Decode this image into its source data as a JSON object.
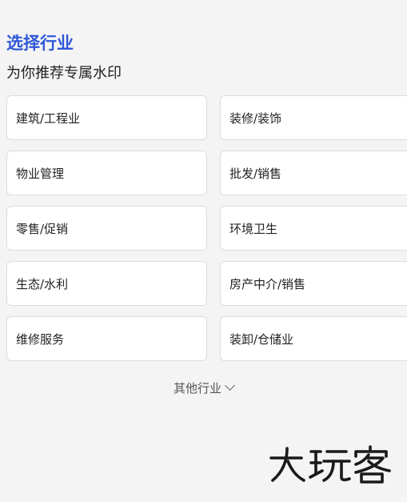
{
  "header": {
    "title": "选择行业",
    "subtitle": "为你推荐专属水印"
  },
  "industries": [
    {
      "label": "建筑/工程业"
    },
    {
      "label": "装修/装饰"
    },
    {
      "label": "物业管理"
    },
    {
      "label": "批发/销售"
    },
    {
      "label": "零售/促销"
    },
    {
      "label": "环境卫生"
    },
    {
      "label": "生态/水利"
    },
    {
      "label": "房产中介/销售"
    },
    {
      "label": "维修服务"
    },
    {
      "label": "装卸/仓储业"
    }
  ],
  "other": {
    "label": "其他行业",
    "icon": "chevron-down-icon"
  },
  "watermark": {
    "text": "大玩客"
  },
  "colors": {
    "accent": "#2f57d8",
    "background": "#f4f4f4",
    "card": "#ffffff"
  }
}
